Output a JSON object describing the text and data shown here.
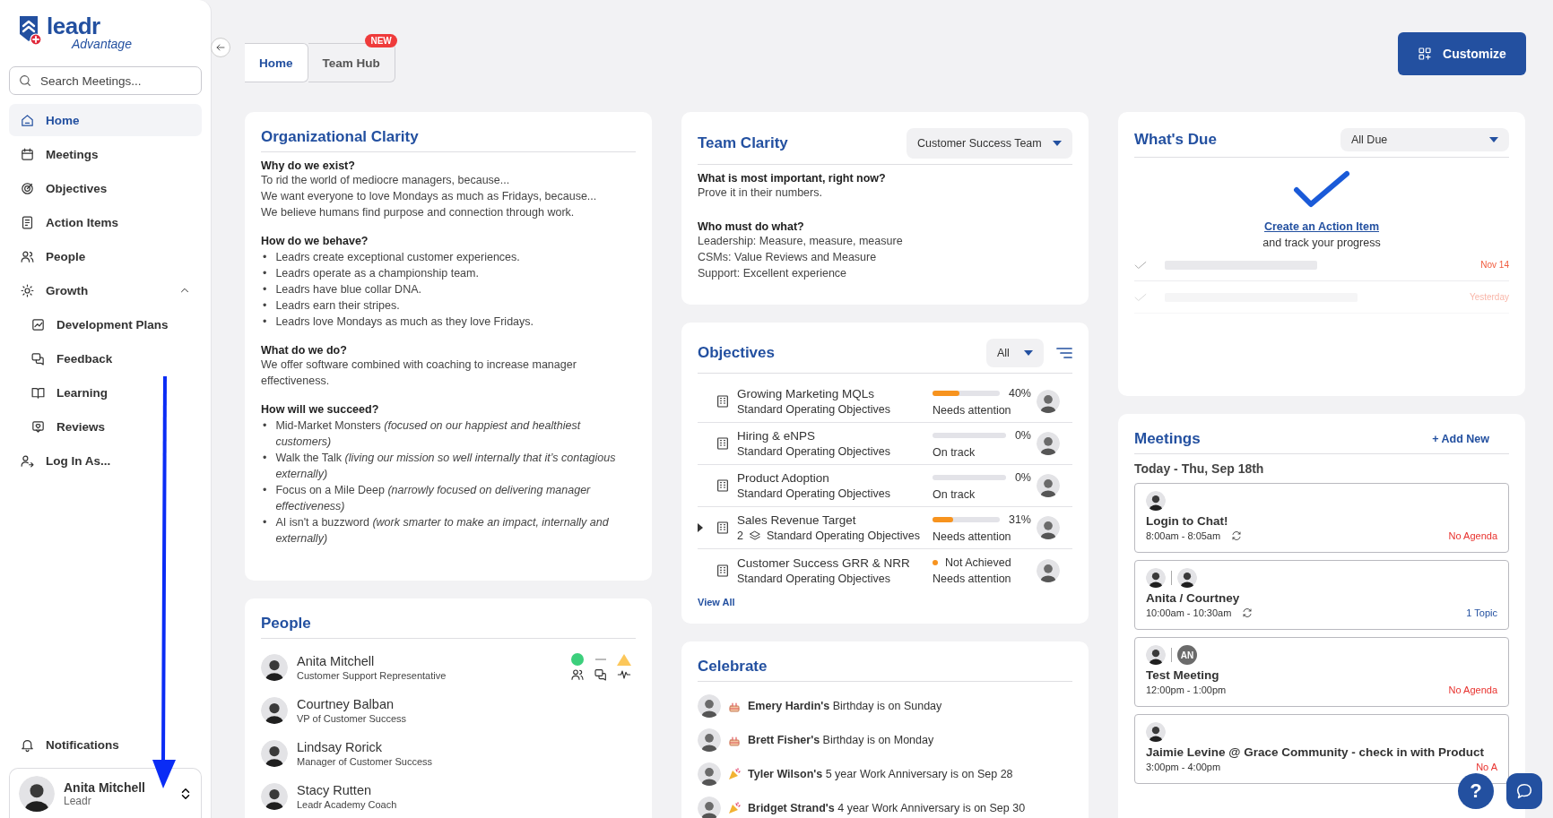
{
  "sidebar": {
    "logo": {
      "name": "leadr",
      "tagline": "Advantage"
    },
    "search": {
      "placeholder": "Search Meetings..."
    },
    "items": [
      {
        "label": "Home",
        "selected": true
      },
      {
        "label": "Meetings",
        "selected": false
      },
      {
        "label": "Objectives",
        "selected": false
      },
      {
        "label": "Action Items",
        "selected": false
      },
      {
        "label": "People",
        "selected": false
      },
      {
        "label": "Growth",
        "selected": false,
        "expanded": true,
        "children": [
          {
            "label": "Development Plans",
            "selected": false
          },
          {
            "label": "Feedback",
            "selected": false
          },
          {
            "label": "Learning",
            "selected": false
          },
          {
            "label": "Reviews",
            "selected": false
          }
        ]
      },
      {
        "label": "Log In As...",
        "selected": false
      }
    ],
    "notifications": {
      "label": "Notifications"
    },
    "user": {
      "name": "Anita Mitchell",
      "org": "Leadr"
    }
  },
  "tabs": [
    {
      "label": "Home",
      "selected": true
    },
    {
      "label": "Team Hub",
      "selected": false,
      "badge": "NEW"
    }
  ],
  "customize_button": {
    "label": "Customize"
  },
  "org_clarity": {
    "title": "Organizational Clarity",
    "sections": [
      {
        "heading": "Why do we exist?",
        "kind": "lines",
        "lines": [
          "To rid the world of mediocre managers, because...",
          "We want everyone to love Mondays as much as Fridays, because...",
          "We believe humans find purpose and connection through work."
        ]
      },
      {
        "heading": "How do we behave?",
        "kind": "bullets",
        "marker": "•",
        "lines": [
          "Leadrs create exceptional customer experiences.",
          "Leadrs operate as a championship team.",
          "Leadrs have blue collar DNA.",
          "Leadrs earn their stripes.",
          "Leadrs love Mondays as much as they love Fridays."
        ]
      },
      {
        "heading": "What do we do?",
        "kind": "lines",
        "lines": [
          "We offer software combined with coaching to increase manager effectiveness."
        ]
      },
      {
        "heading": "How will we succeed?",
        "kind": "bullets",
        "marker": "•",
        "lines": [
          "Mid-Market Monsters *(focused on our happiest and healthiest customers)*",
          "Walk the Talk *(living our mission so well internally that it’s contagious externally)*",
          "Focus on a Mile Deep *(narrowly focused on delivering manager effectiveness)*",
          "AI isn't a buzzword *(work smarter to make an impact, internally and externally)*"
        ]
      }
    ]
  },
  "people": {
    "title": "People",
    "rows": [
      {
        "name": "Anita Mitchell",
        "role": "Customer Support Representative",
        "indicators": true
      },
      {
        "name": "Courtney Balban",
        "role": "VP of Customer Success",
        "indicators": false
      },
      {
        "name": "Lindsay Rorick",
        "role": "Manager of Customer Success",
        "indicators": false
      },
      {
        "name": "Stacy Rutten",
        "role": "Leadr Academy Coach",
        "indicators": false
      }
    ]
  },
  "team_clarity": {
    "title": "Team Clarity",
    "team_select": {
      "value": "Customer Success Team"
    },
    "sections": [
      {
        "heading": "What is most important, right now?",
        "lines": [
          "Prove it in their numbers."
        ]
      },
      {
        "heading": "Who must do what?",
        "lines": [
          "Leadership: Measure, measure, measure",
          "CSMs: Value Reviews and Measure",
          "Support: Excellent experience"
        ]
      }
    ]
  },
  "objectives": {
    "title": "Objectives",
    "filter": {
      "value": "All"
    },
    "rows": [
      {
        "name": "Growing Marketing MQLs",
        "category": "Standard Operating Objectives",
        "kind": "progress",
        "level": 0.4,
        "percent": "40%",
        "status": "Needs attention",
        "expandable": false
      },
      {
        "name": "Hiring & eNPS",
        "category": "Standard Operating Objectives",
        "kind": "progress",
        "level": 0,
        "percent": "0%",
        "status": "On track",
        "expandable": false
      },
      {
        "name": "Product Adoption",
        "category": "Standard Operating Objectives",
        "kind": "progress",
        "level": 0,
        "percent": "0%",
        "status": "On track",
        "expandable": false
      },
      {
        "name": "Sales Revenue Target",
        "child_count": "2",
        "category": "Standard Operating Objectives",
        "kind": "progress",
        "level": 0.31,
        "percent": "31%",
        "status": "Needs attention",
        "expandable": true
      },
      {
        "name": "Customer Success GRR & NRR",
        "category": "Standard Operating Objectives",
        "kind": "result",
        "result": "Not Achieved",
        "status": "Needs attention",
        "expandable": false
      }
    ],
    "view_all": "View All"
  },
  "celebrate": {
    "title": "Celebrate",
    "rows": [
      {
        "kind": "birthday",
        "text": "**Emery Hardin's** Birthday is on Sunday"
      },
      {
        "kind": "birthday",
        "text": "**Brett Fisher's** Birthday is on Monday"
      },
      {
        "kind": "anniversary",
        "text": "**Tyler Wilson's** 5 year Work Anniversary is on Sep 28"
      },
      {
        "kind": "anniversary",
        "text": "**Bridget Strand's** 4 year Work Anniversary is on Sep 30"
      }
    ]
  },
  "whats_due": {
    "title": "What's Due",
    "filter": {
      "value": "All Due"
    },
    "link": "Create an Action Item",
    "subtitle": "and track your progress",
    "placeholder_rows": [
      {
        "date": "Nov 14",
        "faded": false
      },
      {
        "date": "Yesterday",
        "faded": true
      }
    ]
  },
  "meetings": {
    "title": "Meetings",
    "add_button": "+ Add New",
    "day": "Today - Thu, Sep 18th",
    "items": [
      {
        "attendees": [
          {
            "kind": "photo"
          }
        ],
        "title": "Login to Chat!",
        "time": "8:00am - 8:05am",
        "recurring": true,
        "note": "No Agenda",
        "color": "#e8322e"
      },
      {
        "attendees": [
          {
            "kind": "photo"
          },
          {
            "kind": "photo"
          }
        ],
        "title": "Anita / Courtney",
        "time": "10:00am - 10:30am",
        "recurring": true,
        "note": "1 Topic",
        "color": "#2350a0"
      },
      {
        "attendees": [
          {
            "kind": "photo"
          },
          {
            "kind": "initials",
            "initials": "AN"
          }
        ],
        "title": "Test Meeting",
        "time": "12:00pm - 1:00pm",
        "recurring": false,
        "note": "No Agenda",
        "color": "#e8322e"
      },
      {
        "attendees": [
          {
            "kind": "photo"
          }
        ],
        "title": "Jaimie Levine @ Grace Community - check in with Product",
        "time": "3:00pm - 4:00pm",
        "recurring": false,
        "note": "No A",
        "color": "#e8322e"
      }
    ]
  },
  "help_button": {
    "label": "?"
  }
}
